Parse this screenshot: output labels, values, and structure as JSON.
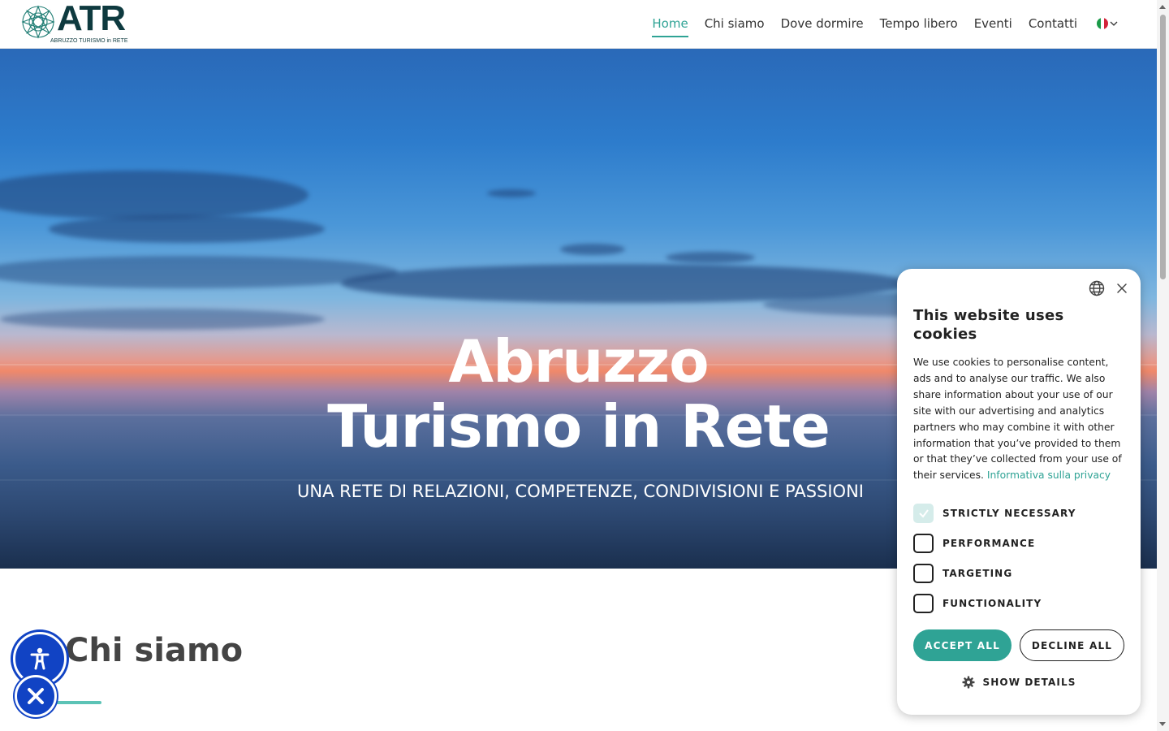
{
  "header": {
    "logo_text": "ATR",
    "logo_subtext": "ABRUZZO TURISMO in RETE",
    "nav": [
      {
        "label": "Home",
        "active": true
      },
      {
        "label": "Chi siamo"
      },
      {
        "label": "Dove dormire"
      },
      {
        "label": "Tempo libero"
      },
      {
        "label": "Eventi"
      },
      {
        "label": "Contatti"
      }
    ],
    "language_icon": "italy-flag-icon"
  },
  "hero": {
    "title_line1": "Abruzzo",
    "title_line2": "Turismo in Rete",
    "subtitle": "UNA RETE DI RELAZIONI, COMPETENZE, CONDIVISIONI E PASSIONI"
  },
  "section": {
    "title": "Chi siamo"
  },
  "cookie": {
    "title": "This website uses cookies",
    "text": "We use cookies to personalise content, ads and to analyse our traffic. We also share information about your use of our site with our advertising and analytics partners who may combine it with other information that you’ve provided to them or that they’ve collected from your use of their services.",
    "privacy_link": "Informativa sulla privacy",
    "options": [
      {
        "label": "STRICTLY NECESSARY",
        "checked": true
      },
      {
        "label": "PERFORMANCE",
        "checked": false
      },
      {
        "label": "TARGETING",
        "checked": false
      },
      {
        "label": "FUNCTIONALITY",
        "checked": false
      }
    ],
    "accept_label": "ACCEPT ALL",
    "decline_label": "DECLINE ALL",
    "details_label": "SHOW DETAILS"
  },
  "colors": {
    "accent": "#2fa395",
    "accessibility_blue": "#1143c4",
    "logo_dark": "#0e3a3f"
  }
}
